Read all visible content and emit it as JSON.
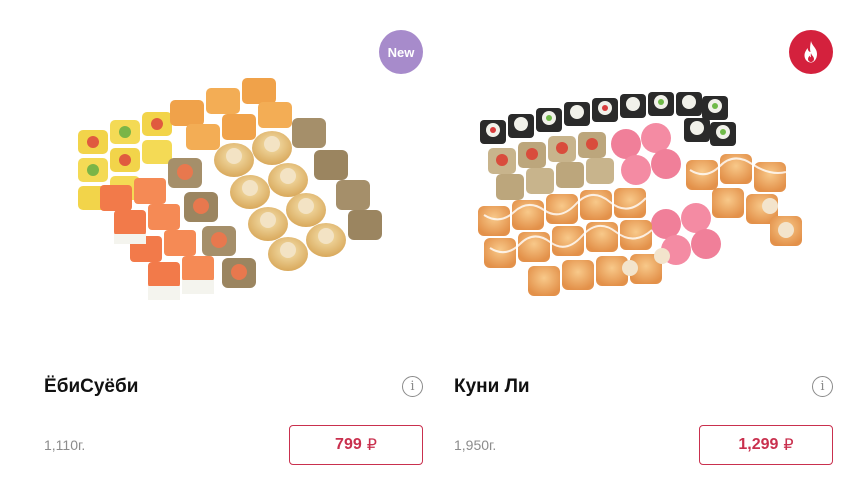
{
  "products": [
    {
      "name": "ЁбиСуёби",
      "weight": "1,110г.",
      "price": "799",
      "currency": "₽",
      "badge": {
        "type": "new",
        "label": "New",
        "color": "#a78bcb"
      },
      "info_icon": "info-icon",
      "image": "sushi-set-photo"
    },
    {
      "name": "Куни Ли",
      "weight": "1,950г.",
      "price": "1,299",
      "currency": "₽",
      "badge": {
        "type": "hot",
        "label": "",
        "icon": "fire-icon",
        "color": "#d4213d"
      },
      "info_icon": "info-icon",
      "image": "sushi-set-photo"
    }
  ],
  "accent_color": "#c9304e"
}
